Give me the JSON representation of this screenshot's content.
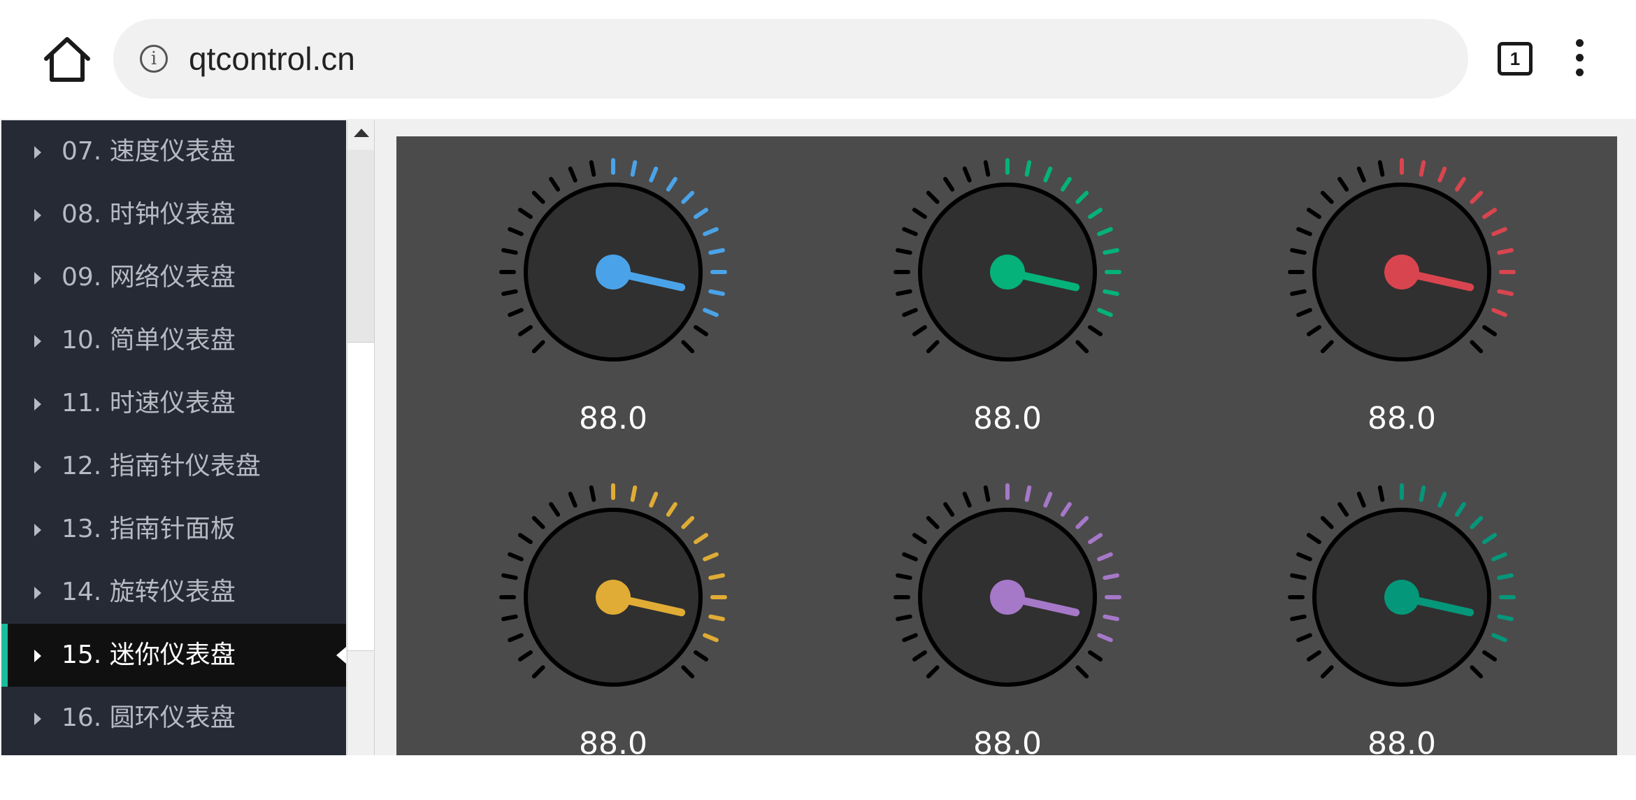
{
  "browser": {
    "url": "qtcontrol.cn",
    "tab_count": "1",
    "info_glyph": "i"
  },
  "sidebar": {
    "items": [
      {
        "label": "07. 速度仪表盘",
        "active": false
      },
      {
        "label": "08. 时钟仪表盘",
        "active": false
      },
      {
        "label": "09. 网络仪表盘",
        "active": false
      },
      {
        "label": "10. 简单仪表盘",
        "active": false
      },
      {
        "label": "11. 时速仪表盘",
        "active": false
      },
      {
        "label": "12. 指南针仪表盘",
        "active": false
      },
      {
        "label": "13. 指南针面板",
        "active": false
      },
      {
        "label": "14. 旋转仪表盘",
        "active": false
      },
      {
        "label": "15. 迷你仪表盘",
        "active": true
      },
      {
        "label": "16. 圆环仪表盘",
        "active": false
      }
    ],
    "accent_color": "#1abc9c"
  },
  "gauges": [
    {
      "value": "88.0",
      "color": "#4aa3e8"
    },
    {
      "value": "88.0",
      "color": "#05b27a"
    },
    {
      "value": "88.0",
      "color": "#d9454f"
    },
    {
      "value": "88.0",
      "color": "#e0ac35"
    },
    {
      "value": "88.0",
      "color": "#a678c8"
    },
    {
      "value": "88.0",
      "color": "#05977a"
    }
  ],
  "colors": {
    "panel_bg": "#4b4b4b",
    "dial_fill": "#303030",
    "tick_default": "#000000"
  }
}
